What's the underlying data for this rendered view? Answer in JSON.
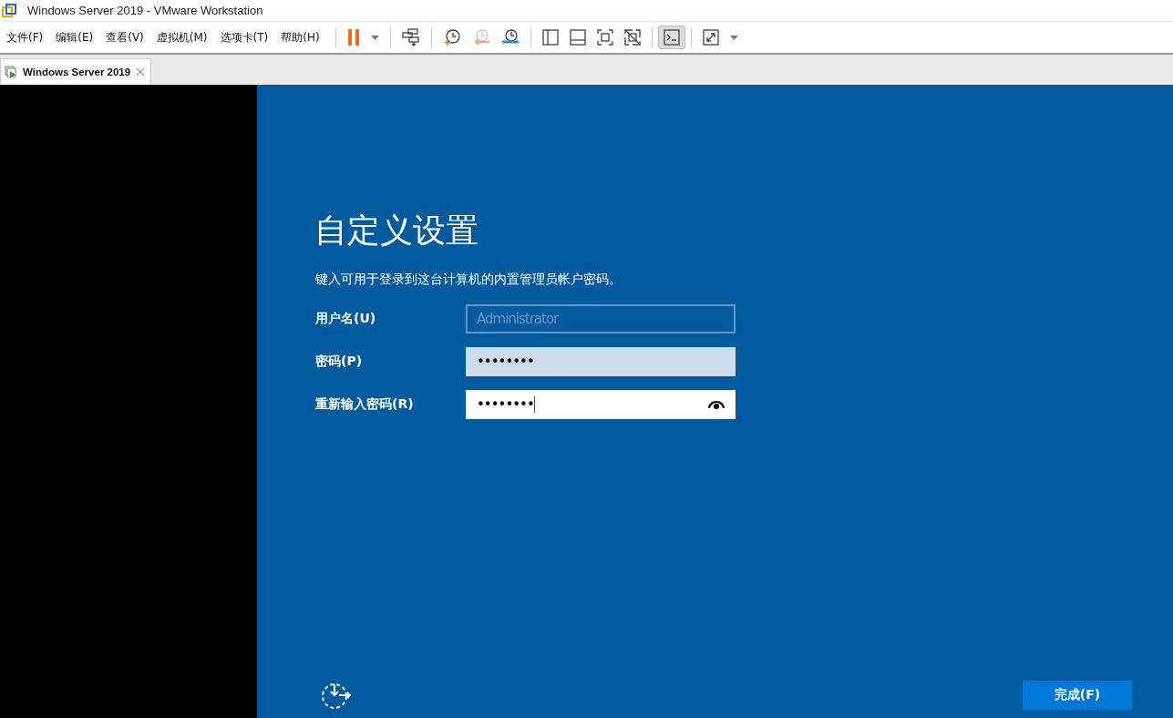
{
  "window": {
    "title": "Windows Server 2019 - VMware Workstation"
  },
  "menu": [
    "文件(F)",
    "编辑(E)",
    "查看(V)",
    "虚拟机(M)",
    "选项卡(T)",
    "帮助(H)"
  ],
  "toolbar": [
    [
      {
        "kind": "pause",
        "selected": false
      },
      {
        "kind": "caret",
        "selected": false
      }
    ],
    [
      {
        "kind": "sendkeys",
        "selected": false
      }
    ],
    [
      {
        "kind": "snap-take",
        "selected": false
      },
      {
        "kind": "snap-revert",
        "selected": false
      },
      {
        "kind": "snap-manage",
        "selected": false
      }
    ],
    [
      {
        "kind": "view-library",
        "selected": false
      },
      {
        "kind": "view-thumb",
        "selected": false
      },
      {
        "kind": "view-full",
        "selected": false
      },
      {
        "kind": "view-unity",
        "selected": false
      }
    ],
    [
      {
        "kind": "console",
        "selected": true
      }
    ],
    [
      {
        "kind": "stretch",
        "selected": false
      },
      {
        "kind": "caret",
        "selected": false
      }
    ]
  ],
  "tabs": [
    {
      "label": "Windows Server 2019",
      "selected": true
    }
  ],
  "setup": {
    "title": "自定义设置",
    "description": "键入可用于登录到这台计算机的内置管理员帐户密码。",
    "fields": [
      {
        "label": "用户名(U)",
        "value": "Administrator",
        "disabled": true,
        "highlighted": false,
        "focused": false,
        "reveal": false
      },
      {
        "label": "密码(P)",
        "value": "••••••••",
        "disabled": false,
        "highlighted": true,
        "focused": false,
        "reveal": false
      },
      {
        "label": "重新输入密码(R)",
        "value": "••••••••",
        "disabled": false,
        "highlighted": false,
        "focused": true,
        "reveal": true
      }
    ],
    "finish_button": "完成(F)"
  }
}
